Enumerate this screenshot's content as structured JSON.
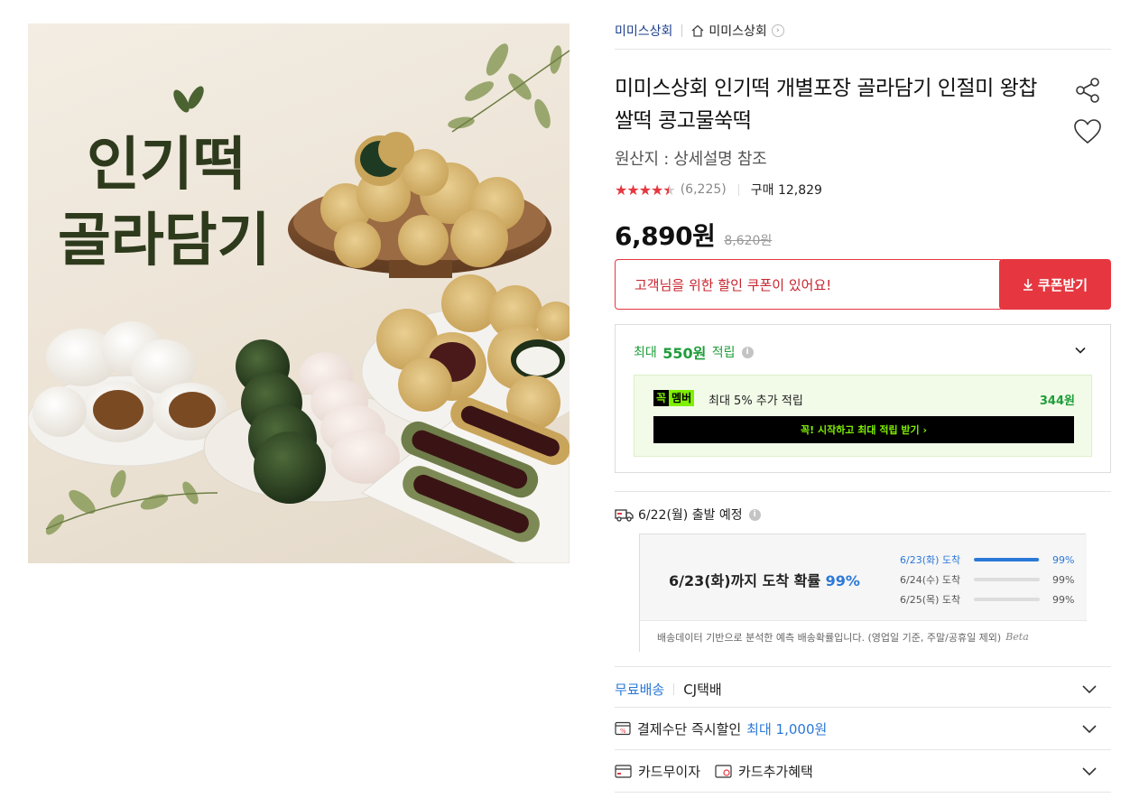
{
  "product_image": {
    "headline_line1": "인기떡",
    "headline_line2": "골라담기"
  },
  "breadcrumb": {
    "seller": "미미스상회",
    "shop": "미미스상회"
  },
  "product": {
    "title": "미미스상회 인기떡 개별포장 골라담기 인절미 왕찹쌀떡 콩고물쑥떡",
    "origin": "원산지 : 상세설명 참조",
    "rating": 4.5,
    "review_count": "(6,225)",
    "sales": "구매 12,829",
    "price": "6,890원",
    "original_price": "8,620원"
  },
  "coupon": {
    "message": "고객님을 위한 할인 쿠폰이 있어요!",
    "button_label": "쿠폰받기"
  },
  "reward": {
    "prefix": "최대",
    "amount": "550원",
    "suffix": "적립",
    "member_logo_a": "꼭",
    "member_logo_b": "멤버",
    "member_text": "최대 5% 추가 적립",
    "member_amount": "344원",
    "member_button": "꼭! 시작하고 최대 적립 받기 ›"
  },
  "shipping": {
    "departure": "6/22(월) 출발 예정",
    "prob_main_prefix": "6/23(화)까지 도착 확률",
    "prob_main_pct": "99%",
    "rows": [
      {
        "label": "6/23(화) 도착",
        "value": "99%",
        "level": 0.99
      },
      {
        "label": "6/24(수) 도착",
        "value": "99%",
        "level": 0
      },
      {
        "label": "6/25(목) 도착",
        "value": "99%",
        "level": 0
      }
    ],
    "note": "배송데이터 기반으로 분석한 예측 배송확률입니다. (영업일 기준, 주말/공휴일 제외)",
    "beta": "Beta"
  },
  "delivery": {
    "free_label": "무료배송",
    "carrier": "CJ택배"
  },
  "payment": {
    "label": "결제수단 즉시할인",
    "max": "최대 1,000원"
  },
  "card": {
    "installment": "카드무이자",
    "benefit": "카드추가혜택"
  },
  "colors": {
    "accent_red": "#e63740",
    "reward_green": "#1f9d3a",
    "member_lime": "#7ff000",
    "link_blue": "#2a78d8"
  }
}
